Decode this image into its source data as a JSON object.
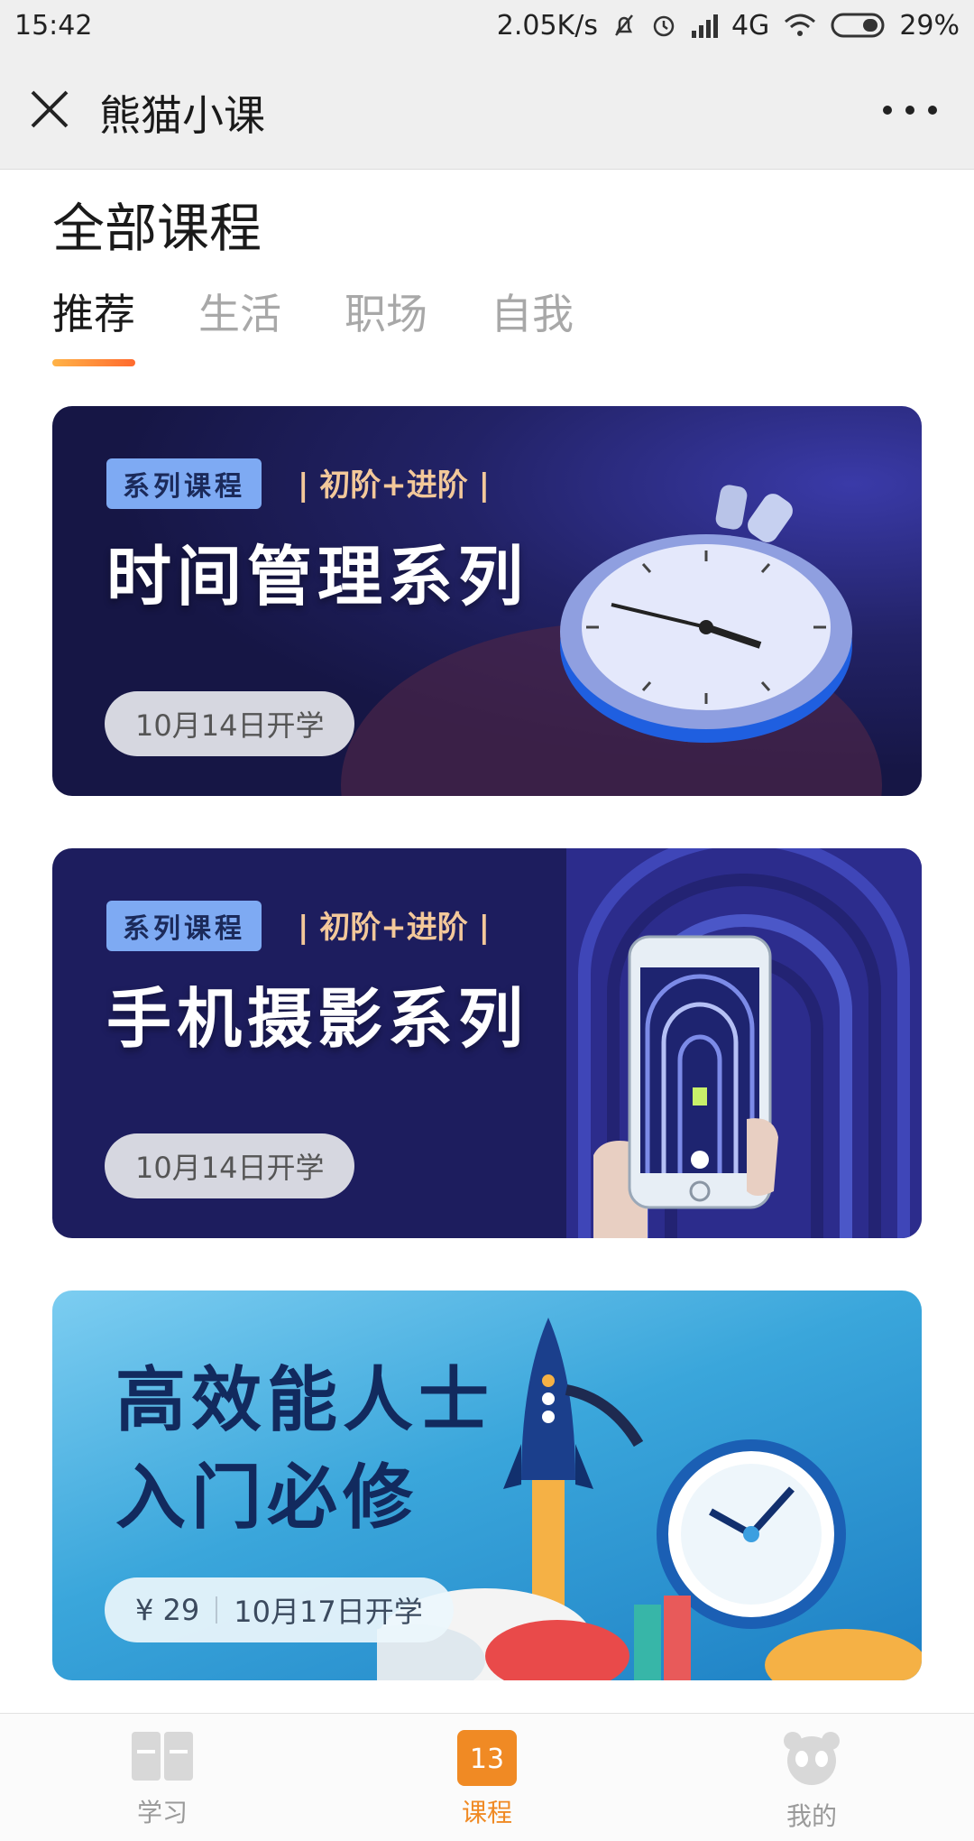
{
  "status_bar": {
    "time": "15:42",
    "net_speed": "2.05K/s",
    "network": "4G",
    "battery": "29%"
  },
  "nav": {
    "title": "熊猫小课"
  },
  "page": {
    "title": "全部课程"
  },
  "tabs": [
    {
      "label": "推荐",
      "active": true
    },
    {
      "label": "生活",
      "active": false
    },
    {
      "label": "职场",
      "active": false
    },
    {
      "label": "自我",
      "active": false
    }
  ],
  "cards": [
    {
      "badge": "系列课程",
      "level": "| 初阶+进阶 |",
      "title": "时间管理系列",
      "date": "10月14日开学",
      "art": "stopwatch-illustration"
    },
    {
      "badge": "系列课程",
      "level": "| 初阶+进阶 |",
      "title": "手机摄影系列",
      "date": "10月14日开学",
      "art": "phone-photo-illustration"
    },
    {
      "title_line1": "高效能人士",
      "title_line2": "入门必修",
      "price": "¥ 29",
      "date": "10月17日开学",
      "art": "rocket-clock-illustration"
    }
  ],
  "bottom_nav": [
    {
      "label": "学习",
      "icon": "book-icon",
      "active": false
    },
    {
      "label": "课程",
      "icon": "calendar-icon",
      "calendar_day": "13",
      "active": true
    },
    {
      "label": "我的",
      "icon": "panda-icon",
      "active": false
    }
  ],
  "colors": {
    "accent": "#f08a24",
    "tab_underline_start": "#ffb347",
    "tab_underline_end": "#ff6a2e",
    "card_dark": "#161645",
    "card_light": "#3aa6db"
  }
}
